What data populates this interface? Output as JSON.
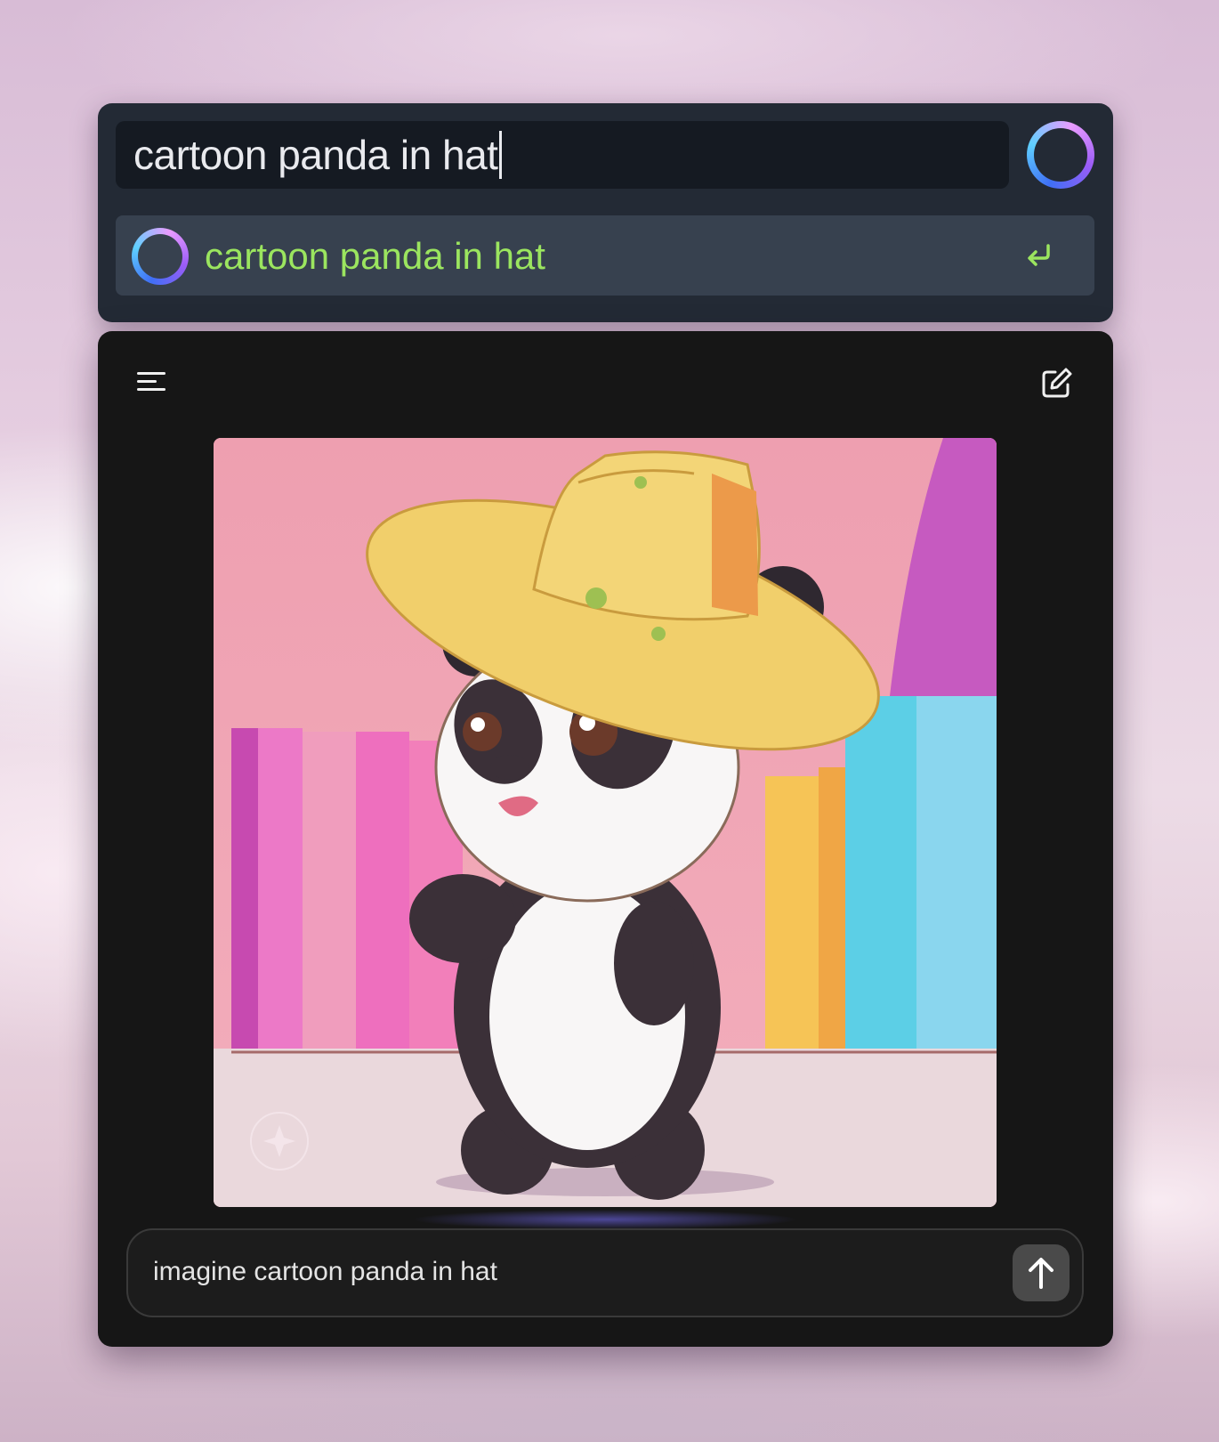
{
  "launcher": {
    "query": "cartoon panda in hat",
    "suggestion": "cartoon panda in hat",
    "enter_icon": "return-icon",
    "assistant_icon": "meta-ai-ring-icon"
  },
  "chat": {
    "menu_icon": "menu-icon",
    "compose_icon": "new-chat-icon",
    "image_description_alt": "cartoon panda in hat",
    "composer_text": "imagine cartoon panda in hat",
    "send_icon": "arrow-up-icon"
  },
  "colors": {
    "launcher_bg": "#232a35",
    "suggestion_bg": "#37414f",
    "suggestion_text": "#9be55f",
    "chat_bg": "#161616"
  }
}
